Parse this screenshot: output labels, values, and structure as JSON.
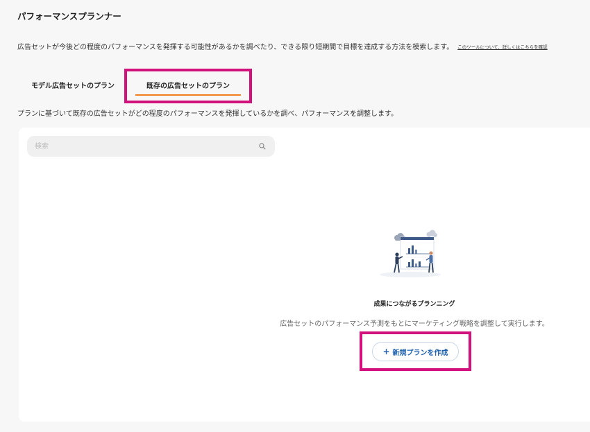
{
  "header": {
    "title": "パフォーマンスプランナー",
    "intro_text": "広告セットが今後どの程度のパフォーマンスを発揮する可能性があるかを調べたり、できる限り短期間で目標を達成する方法を模索します。",
    "intro_link": "このツールについて、詳しくはこちらを確認"
  },
  "tabs": [
    {
      "label": "モデル広告セットのプラン",
      "active": false
    },
    {
      "label": "既存の広告セットのプラン",
      "active": true
    }
  ],
  "tab_description": "プランに基づいて既存の広告セットがどの程度のパフォーマンスを発揮しているかを調べ、パフォーマンスを調整します。",
  "search": {
    "placeholder": "検索",
    "icon": "search-icon"
  },
  "empty_state": {
    "title": "成果につながるプランニング",
    "description": "広告セットのパフォーマンス予測をもとにマーケティング戦略を調整して実行します。",
    "button_label": "新規プランを作成",
    "button_icon": "plus-icon"
  },
  "colors": {
    "highlight": "#d3117d",
    "tab_underline": "#f07e1d",
    "button_text": "#1d5fad",
    "page_bg": "#f7f7f7"
  }
}
